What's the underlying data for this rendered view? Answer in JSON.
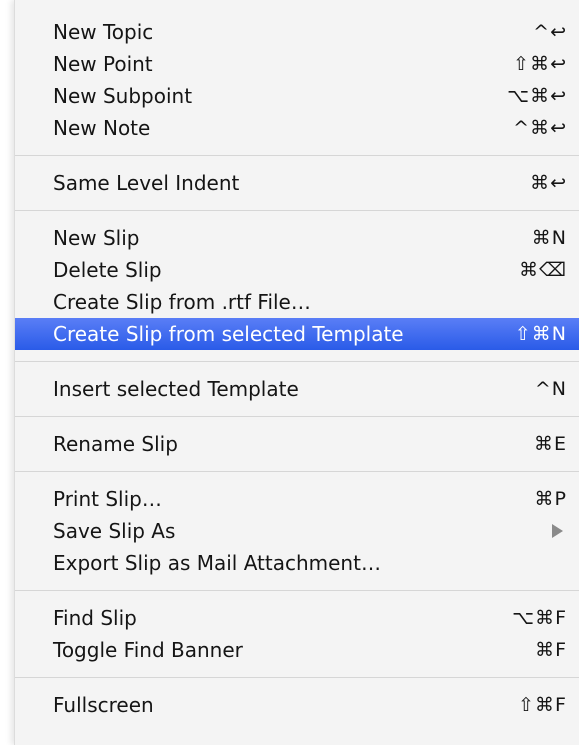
{
  "menu": {
    "groups": [
      {
        "items": [
          {
            "label": "New Topic",
            "shortcut": "^↩"
          },
          {
            "label": "New Point",
            "shortcut": "⇧⌘↩"
          },
          {
            "label": "New Subpoint",
            "shortcut": "⌥⌘↩"
          },
          {
            "label": "New Note",
            "shortcut": "^⌘↩"
          }
        ]
      },
      {
        "items": [
          {
            "label": "Same Level Indent",
            "shortcut": "⌘↩"
          }
        ]
      },
      {
        "items": [
          {
            "label": "New Slip",
            "shortcut": "⌘N"
          },
          {
            "label": "Delete Slip",
            "shortcut": "⌘⌫"
          },
          {
            "label": "Create Slip from .rtf File…",
            "shortcut": ""
          },
          {
            "label": "Create Slip from selected Template",
            "shortcut": "⇧⌘N",
            "selected": true
          }
        ]
      },
      {
        "items": [
          {
            "label": "Insert selected Template",
            "shortcut": "^N"
          }
        ]
      },
      {
        "items": [
          {
            "label": "Rename Slip",
            "shortcut": "⌘E"
          }
        ]
      },
      {
        "items": [
          {
            "label": "Print Slip…",
            "shortcut": "⌘P"
          },
          {
            "label": "Save Slip As",
            "shortcut": "",
            "submenu": true
          },
          {
            "label": "Export Slip as Mail Attachment…",
            "shortcut": ""
          }
        ]
      },
      {
        "items": [
          {
            "label": "Find Slip",
            "shortcut": "⌥⌘F"
          },
          {
            "label": "Toggle Find Banner",
            "shortcut": "⌘F"
          }
        ]
      },
      {
        "items": [
          {
            "label": "Fullscreen",
            "shortcut": "⇧⌘F"
          }
        ]
      }
    ],
    "colors": {
      "background": "#f4f4f4",
      "highlight": "#3a68ee",
      "text": "#151515",
      "separator": "#d6d6d6"
    }
  }
}
